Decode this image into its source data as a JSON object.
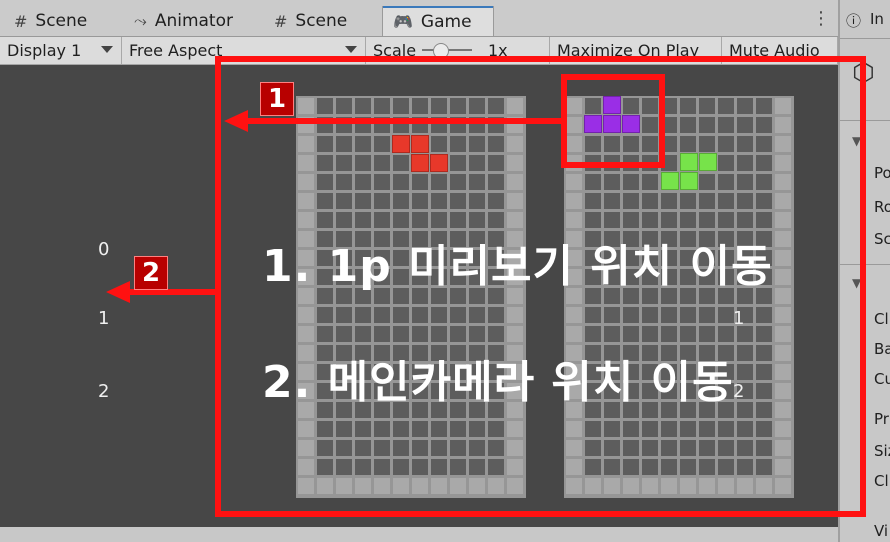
{
  "tabs": [
    {
      "label": "Scene",
      "icon": "grid-icon"
    },
    {
      "label": "Animator",
      "icon": "animator-icon"
    },
    {
      "label": "Scene",
      "icon": "grid-icon"
    },
    {
      "label": "Game",
      "icon": "gamepad-icon",
      "active": true
    }
  ],
  "toolbar": {
    "display": "Display 1",
    "aspect": "Free Aspect",
    "scale_label": "Scale",
    "scale_value": "1x",
    "maximize": "Maximize On Play",
    "mute": "Mute Audio"
  },
  "game": {
    "left_numbers": [
      "0",
      "1",
      "2"
    ],
    "right_numbers": [
      "1",
      "2"
    ],
    "pieces": {
      "red": "#e8382a",
      "purple": "#9a2ee6",
      "green": "#77e34a"
    }
  },
  "annotations": {
    "badge1": "1",
    "badge2": "2",
    "note1": "1.  1p 미리보기 위치 이동",
    "note2": "2.  메인카메라 위치 이동",
    "color": "#ff1111"
  },
  "inspector": {
    "lines": [
      "In",
      "Po",
      "Ro",
      "Sc",
      "Cl",
      "Ba",
      "Cu",
      "Pr",
      "Siz",
      "Cl",
      "Vi"
    ]
  }
}
